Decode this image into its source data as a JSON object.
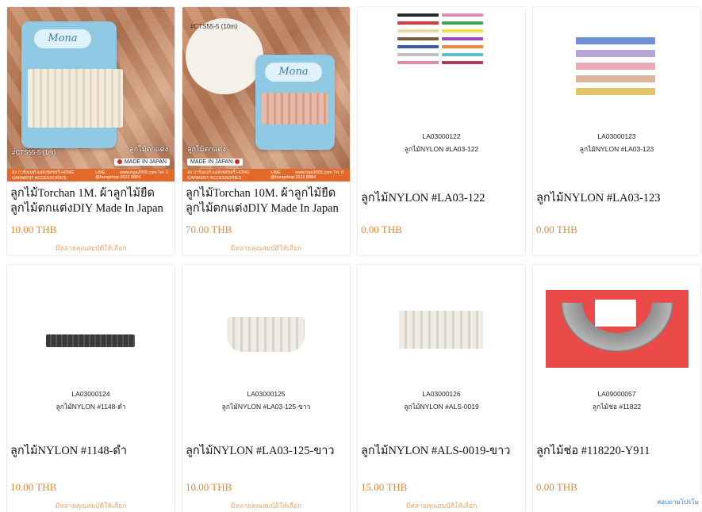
{
  "products": [
    {
      "title": "ลูกไม้Torchan 1M. ผ้าลูกไม้ยืด ลูกไม้ตกแต่งDIY Made In Japan",
      "price": "10.00 THB",
      "variant_note": "มีหลายคุณสมบัติให้เลือก",
      "image": {
        "brand": "Mona",
        "code": "#CTS55-5 (1m)",
        "caption": "ลูกไม้ตกแต่ง",
        "made_tag": "MADE IN JAPAN",
        "footer_left": "ฮง การ์เมนท์ แอสเซสซอรี่ HONG GARMENT ACCESSORIES",
        "footer_mid": "LINE @hongshop",
        "footer_right": "www.hga2005.com Tel. 0 2622 8884"
      }
    },
    {
      "title": "ลูกไม้Torchan 10M. ผ้าลูกไม้ยืด ลูกไม้ตกแต่งDIY Made In Japan",
      "price": "70.00 THB",
      "variant_note": "มีหลายคุณสมบัติให้เลือก",
      "image": {
        "brand": "Mona",
        "code": "#CTS55-5 (10m)",
        "caption": "ลูกไม้ตกแต่ง",
        "made_tag": "MADE IN JAPAN",
        "footer_left": "ฮง การ์เมนท์ แอสเซสซอรี่ HONG GARMENT ACCESSORIES",
        "footer_mid": "LINE @hongshop",
        "footer_right": "www.hga2005.com Tel. 0 2622 8884"
      }
    },
    {
      "title": "ลูกไม้NYLON #LA03-122",
      "price": "0.00 THB",
      "image": {
        "code": "LA03000122",
        "name": "ลูกไม้NYLON #LA03-122"
      }
    },
    {
      "title": "ลูกไม้NYLON #LA03-123",
      "price": "0.00 THB",
      "image": {
        "code": "LA03000123",
        "name": "ลูกไม้NYLON #LA03-123"
      }
    },
    {
      "title": "ลูกไม้NYLON #1148-ดำ",
      "price": "10.00 THB",
      "variant_note": "มีหลายคุณสมบัติให้เลือก",
      "image": {
        "code": "LA03000124",
        "name": "ลูกไม้NYLON #1148-ดำ"
      }
    },
    {
      "title": "ลูกไม้NYLON #LA03-125-ขาว",
      "price": "10.00 THB",
      "variant_note": "มีหลายคุณสมบัติให้เลือก",
      "image": {
        "code": "LA03000125",
        "name": "ลูกไม้NYLON #LA03-125-ขาว"
      }
    },
    {
      "title": "ลูกไม้NYLON #ALS-0019-ขาว",
      "price": "15.00 THB",
      "variant_note": "มีหลายคุณสมบัติให้เลือก",
      "image": {
        "code": "LA03000126",
        "name": "ลูกไม้NYLON #ALS-0019"
      }
    },
    {
      "title": "ลูกไม้ช่อ #118220-Y911",
      "price": "0.00 THB",
      "image": {
        "code": "LA09000057",
        "name": "ลูกไม้ช่อ #11822"
      }
    }
  ],
  "chat_button": "สอบถามโปรโม",
  "colors": {
    "price": "#e08a3a",
    "variant_note": "#e9a66b",
    "footer_bar": "#e16a2a",
    "chat": "#3a7bd5"
  },
  "swatches_122": [
    "#2b2b2b",
    "#d63b3b",
    "#e9d9a6",
    "#7a5a3a",
    "#3a5ab0",
    "#c0c0c0",
    "#e48ab0",
    "#3ba55a",
    "#f1e24a",
    "#9a4ac0",
    "#f08a3a",
    "#5ac0d0",
    "#b03a5a"
  ],
  "swatches_123": [
    "#6f8fd6",
    "#b7a3d8",
    "#e9a9b8",
    "#d9b5a0",
    "#e3c46a"
  ]
}
